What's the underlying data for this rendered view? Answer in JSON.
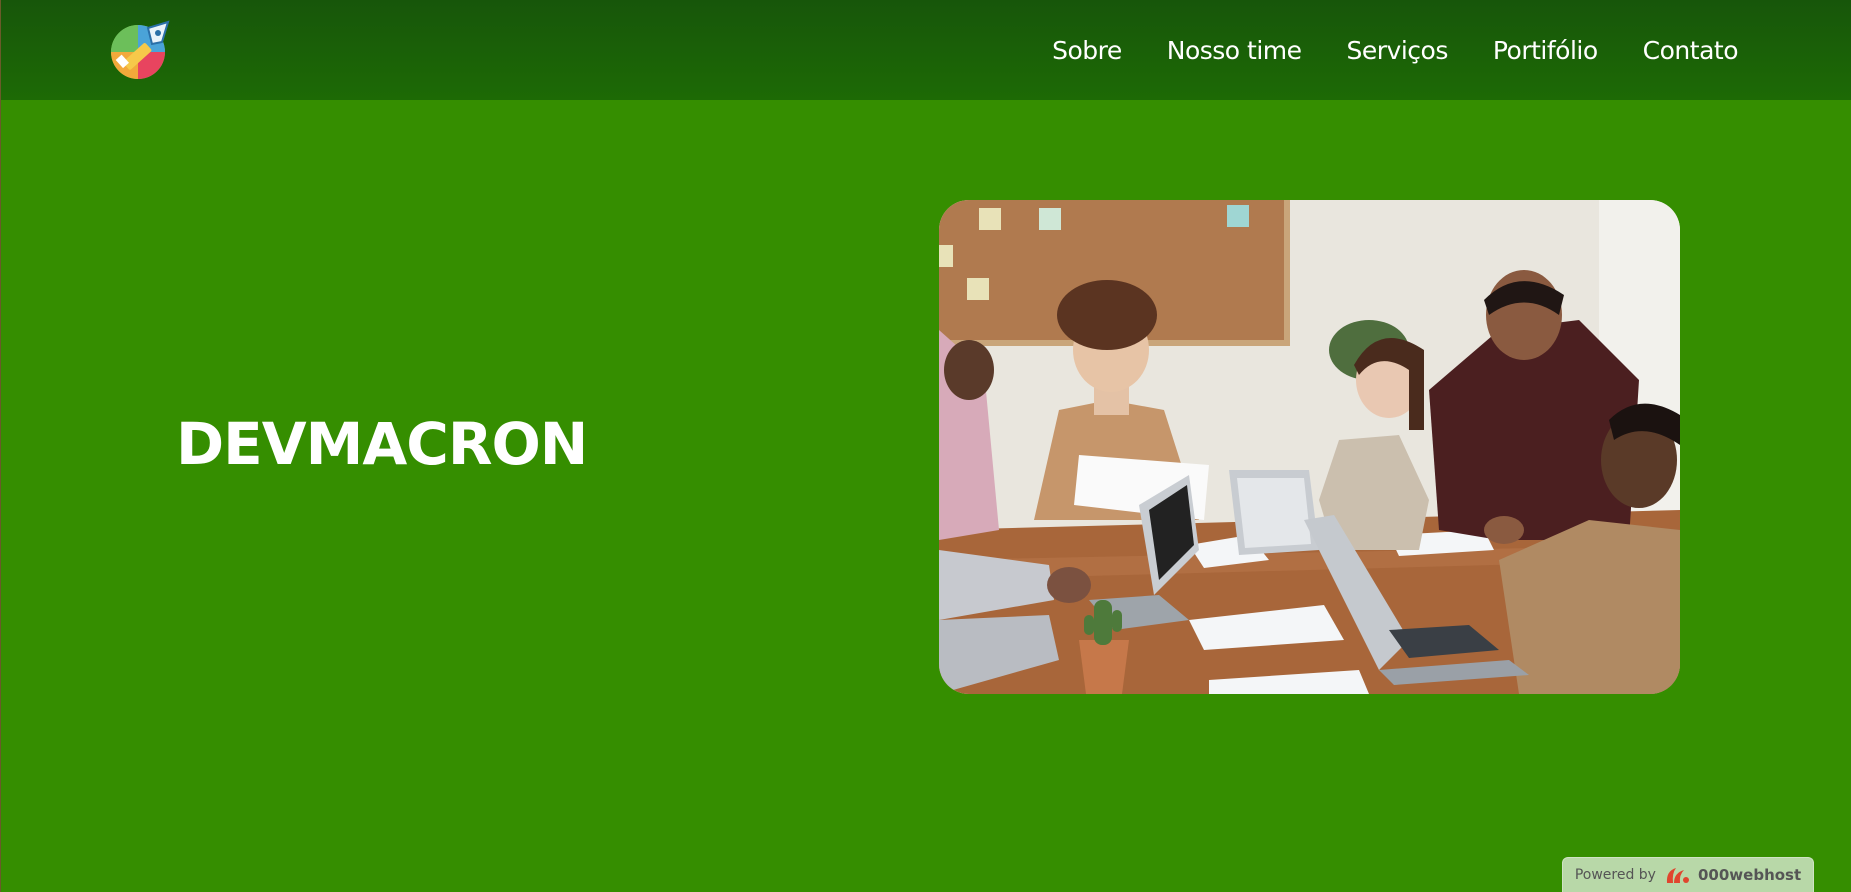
{
  "nav": {
    "items": [
      "Sobre",
      "Nosso time",
      "Serviços",
      "Portifólio",
      "Contato"
    ]
  },
  "hero": {
    "title": "DEVMACRON"
  },
  "badge": {
    "powered_by": "Powered by",
    "brand": "000webhost"
  },
  "colors": {
    "background": "#358e00",
    "header": "#17560a",
    "text": "#ffffff"
  },
  "icons": {
    "logo": "pen-palette-logo-icon",
    "badge_logo": "webhost-logo-icon"
  }
}
